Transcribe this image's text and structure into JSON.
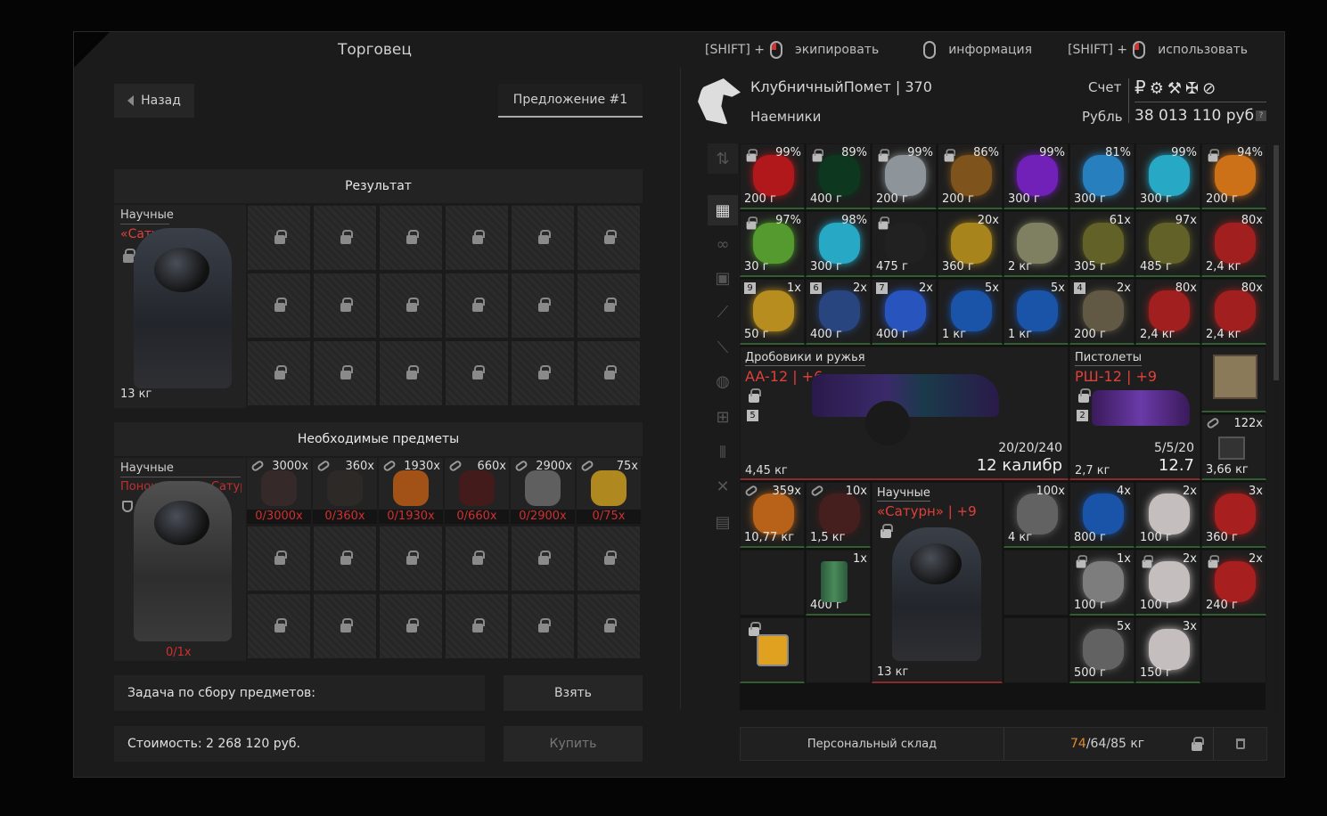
{
  "left": {
    "title": "Торговец",
    "back_label": "Назад",
    "offer_tab": "Предложение #1",
    "result_header": "Результат",
    "result_item": {
      "category": "Научные",
      "name": "«Сатурн»",
      "weight": "13 кг"
    },
    "required_header": "Необходимые предметы",
    "required_item": {
      "category": "Научные",
      "name": "Поношенный «Сатур..",
      "count": "0/1x"
    },
    "required_resources": [
      {
        "qty": "3000x",
        "have": "0/3000x"
      },
      {
        "qty": "360x",
        "have": "0/360x"
      },
      {
        "qty": "1930x",
        "have": "0/1930x"
      },
      {
        "qty": "660x",
        "have": "0/660x"
      },
      {
        "qty": "2900x",
        "have": "0/2900x"
      },
      {
        "qty": "75x",
        "have": "0/75x"
      }
    ],
    "task_label": "Задача по сбору предметов:",
    "take_button": "Взять",
    "cost_label": "Стоимость: 2 268 120 руб.",
    "buy_button": "Купить"
  },
  "hints": {
    "shift1": "[SHIFT] +",
    "equip": "экипировать",
    "info": "информация",
    "shift2": "[SHIFT] +",
    "use": "использовать"
  },
  "player": {
    "name_level": "КлубничныйПомет | 370",
    "faction": "Наемники",
    "account_label": "Счет",
    "currency_label": "Рубль",
    "balance": "38 013 110 руб.",
    "help": "?"
  },
  "inventory": {
    "row1": [
      {
        "pct": "99%",
        "w": "200 г",
        "color": "#c0181c"
      },
      {
        "pct": "89%",
        "w": "400 г",
        "color": "#0c3a1e"
      },
      {
        "pct": "99%",
        "w": "200 г",
        "color": "#9aa2a8"
      },
      {
        "pct": "86%",
        "w": "200 г",
        "color": "#8a5a1c"
      },
      {
        "pct": "99%",
        "w": "300 г",
        "color": "#7a22c8"
      },
      {
        "pct": "81%",
        "w": "300 г",
        "color": "#2a8ad0"
      },
      {
        "pct": "99%",
        "w": "300 г",
        "color": "#28b8d8"
      },
      {
        "pct": "94%",
        "w": "200 г",
        "color": "#e07a18"
      }
    ],
    "row2": [
      {
        "pct": "97%",
        "w": "30 г",
        "color": "#5aa830"
      },
      {
        "pct": "98%",
        "w": "300 г",
        "color": "#28b8d8"
      },
      {
        "pct": "",
        "w": "475 г",
        "color": "#222"
      },
      {
        "pct": "20x",
        "w": "360 г",
        "color": "#b8901c"
      },
      {
        "pct": "",
        "w": "2 кг",
        "color": "#8a8a6a"
      },
      {
        "pct": "61x",
        "w": "305 г",
        "color": "#6a6a2a"
      },
      {
        "pct": "97x",
        "w": "485 г",
        "color": "#6a6a2a"
      },
      {
        "pct": "80x",
        "w": "2,4 кг",
        "color": "#b02020"
      }
    ],
    "row3": [
      {
        "pct": "1x",
        "w": "50 г",
        "num": "9",
        "color": "#c89a20"
      },
      {
        "pct": "2x",
        "w": "400 г",
        "num": "6",
        "color": "#2a4a8a"
      },
      {
        "pct": "2x",
        "w": "400 г",
        "num": "7",
        "color": "#2a5ad0"
      },
      {
        "pct": "5x",
        "w": "1 кг",
        "num": "",
        "color": "#1a5ab8"
      },
      {
        "pct": "5x",
        "w": "1 кг",
        "num": "",
        "color": "#1a5ab8"
      },
      {
        "pct": "2x",
        "w": "200 г",
        "num": "4",
        "color": "#6a604a"
      },
      {
        "pct": "80x",
        "w": "2,4 кг",
        "num": "",
        "color": "#b02020"
      },
      {
        "pct": "80x",
        "w": "2,4 кг",
        "num": "",
        "color": "#b02020"
      }
    ],
    "weapon1": {
      "category": "Дробовики и ружья",
      "name": "AA-12 | +6",
      "num": "5",
      "ammo": "20/20/240",
      "caliber": "12 калибр",
      "w": "4,45 кг"
    },
    "weapon2": {
      "category": "Пистолеты",
      "name": "РШ-12 | +9",
      "num": "2",
      "ammo": "5/5/20",
      "caliber": "12.7",
      "w": "2,7 кг"
    },
    "side_item": {
      "pct": "122x",
      "w": "3,66 кг"
    },
    "row5": [
      {
        "pct": "359x",
        "w": "10,77 кг",
        "color": "#c86a18"
      },
      {
        "pct": "10x",
        "w": "1,5 кг",
        "color": "#4a1e1e"
      }
    ],
    "armor": {
      "category": "Научные",
      "name": "«Сатурн» | +9",
      "w": "13 кг"
    },
    "ore": {
      "pct": "100x",
      "w": "4 кг"
    },
    "row5b": [
      {
        "pct": "4x",
        "w": "800 г",
        "color": "#1a5ab8"
      },
      {
        "pct": "2x",
        "w": "100 г",
        "color": "#d8d0d0"
      },
      {
        "pct": "3x",
        "w": "360 г",
        "color": "#b82020"
      }
    ],
    "can": {
      "pct": "1x",
      "w": "400 г"
    },
    "row6b": [
      {
        "pct": "1x",
        "w": "100 г",
        "color": "#888"
      },
      {
        "pct": "2x",
        "w": "100 г",
        "color": "#d8d0d0"
      },
      {
        "pct": "2x",
        "w": "240 г",
        "color": "#b82020"
      }
    ],
    "row7b": [
      {
        "pct": "5x",
        "w": "500 г",
        "color": "#6a6a6a"
      },
      {
        "pct": "3x",
        "w": "150 г",
        "color": "#d8d0d0"
      }
    ]
  },
  "storage": {
    "label": "Персональный склад",
    "weight_current": "74",
    "weight_rest": "/64/85 кг"
  }
}
